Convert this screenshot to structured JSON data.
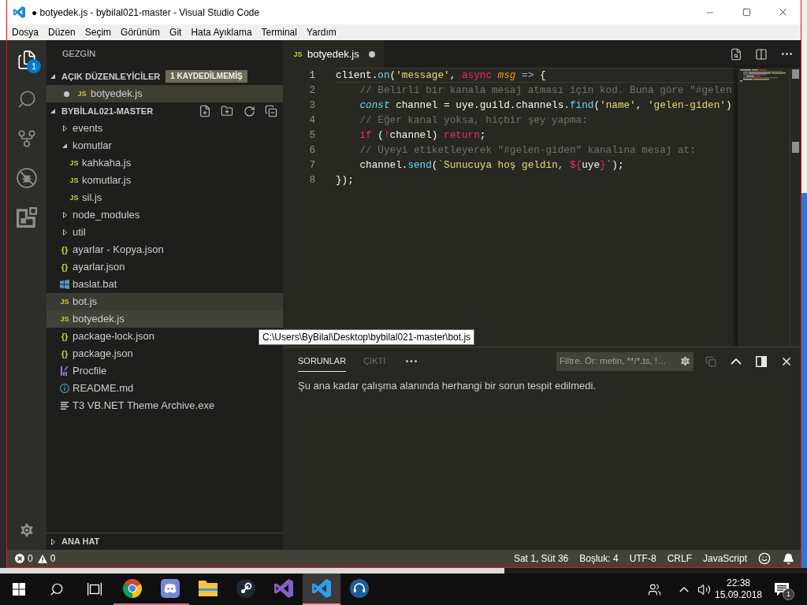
{
  "window": {
    "title": "● botyedek.js - bybilal021-master - Visual Studio Code"
  },
  "menu": [
    "Dosya",
    "Düzen",
    "Seçim",
    "Görünüm",
    "Git",
    "Hata Ayıklama",
    "Terminal",
    "Yardım"
  ],
  "activity_bar": {
    "items": [
      {
        "kind": "files",
        "selected": true,
        "badge": "1"
      },
      {
        "kind": "search",
        "selected": false
      },
      {
        "kind": "scm",
        "selected": false
      },
      {
        "kind": "debug",
        "selected": false
      },
      {
        "kind": "extensions",
        "selected": false
      }
    ]
  },
  "sidebar": {
    "title": "GEZGİN",
    "open_editors": {
      "title": "AÇIK DÜZENLEYİCİLER",
      "expanded": true,
      "badge": "1 KAYDEDİLMEMİŞ",
      "items": [
        {
          "label": "botyedek.js",
          "kind": "js",
          "icon": "JS",
          "dirty": true,
          "selected": true
        }
      ]
    },
    "folder": {
      "title": "BYBİLAL021-MASTER",
      "expanded": true,
      "items": [
        {
          "label": "events",
          "kind": "folder",
          "expanded": false,
          "selected": false,
          "hovered": false
        },
        {
          "label": "komutlar",
          "kind": "folder",
          "expanded": true,
          "selected": false,
          "hovered": false,
          "children": [
            {
              "label": "kahkaha.js",
              "kind": "js",
              "icon": "JS",
              "selected": false,
              "hovered": false
            },
            {
              "label": "komutlar.js",
              "kind": "js",
              "icon": "JS",
              "selected": false,
              "hovered": false
            },
            {
              "label": "sil.js",
              "kind": "js",
              "icon": "JS",
              "selected": false,
              "hovered": false
            }
          ]
        },
        {
          "label": "node_modules",
          "kind": "folder",
          "expanded": false,
          "selected": false,
          "hovered": false
        },
        {
          "label": "util",
          "kind": "folder",
          "expanded": false,
          "selected": false,
          "hovered": false
        },
        {
          "label": "ayarlar - Kopya.json",
          "kind": "json",
          "icon": "{}",
          "selected": false,
          "hovered": false
        },
        {
          "label": "ayarlar.json",
          "kind": "json",
          "icon": "{}",
          "selected": false,
          "hovered": false
        },
        {
          "label": "baslat.bat",
          "kind": "bat",
          "selected": false,
          "hovered": false
        },
        {
          "label": "bot.js",
          "kind": "js",
          "icon": "JS",
          "selected": false,
          "hovered": true
        },
        {
          "label": "botyedek.js",
          "kind": "js",
          "icon": "JS",
          "selected": true,
          "hovered": false
        },
        {
          "label": "package-lock.json",
          "kind": "json",
          "icon": "{}",
          "selected": false,
          "hovered": false
        },
        {
          "label": "package.json",
          "kind": "json",
          "icon": "{}",
          "selected": false,
          "hovered": false
        },
        {
          "label": "Procfile",
          "kind": "procfile",
          "selected": false,
          "hovered": false
        },
        {
          "label": "README.md",
          "kind": "md",
          "selected": false,
          "hovered": false
        },
        {
          "label": "T3 VB.NET Theme Archive.exe",
          "kind": "exe",
          "selected": false,
          "hovered": false
        }
      ]
    },
    "outline": {
      "title": "ANA HAT",
      "expanded": false
    }
  },
  "editor": {
    "tabs": [
      {
        "label": "botyedek.js",
        "kind": "js",
        "icon": "JS",
        "dirty": true,
        "selected": true
      }
    ],
    "lines": [
      {
        "number": "1",
        "current": true,
        "tokens": [
          {
            "kind": "plain",
            "text": "client."
          },
          {
            "kind": "function",
            "text": "on"
          },
          {
            "kind": "plain",
            "text": "("
          },
          {
            "kind": "string",
            "text": "'message'"
          },
          {
            "kind": "plain",
            "text": ", "
          },
          {
            "kind": "keyword",
            "text": "async "
          },
          {
            "kind": "param",
            "text": "msg"
          },
          {
            "kind": "operator",
            "text": " =>"
          },
          {
            "kind": "plain",
            "text": " {"
          }
        ]
      },
      {
        "number": "2",
        "current": false,
        "tokens": [
          {
            "kind": "comment",
            "text": "    // Belirli bir kanala mesaj atması için kod. Buna göre \"#gelen"
          }
        ]
      },
      {
        "number": "3",
        "current": false,
        "tokens": [
          {
            "kind": "storage",
            "text": "    const"
          },
          {
            "kind": "plain",
            "text": " channel = uye.guild.channels."
          },
          {
            "kind": "function",
            "text": "find"
          },
          {
            "kind": "plain",
            "text": "("
          },
          {
            "kind": "string",
            "text": "'name'"
          },
          {
            "kind": "plain",
            "text": ", "
          },
          {
            "kind": "string",
            "text": "'gelen-giden'"
          },
          {
            "kind": "plain",
            "text": ")"
          }
        ]
      },
      {
        "number": "4",
        "current": false,
        "tokens": [
          {
            "kind": "comment",
            "text": "    // Eğer kanal yoksa, hiçbir şey yapma:"
          }
        ]
      },
      {
        "number": "5",
        "current": false,
        "tokens": [
          {
            "kind": "keyword",
            "text": "    if"
          },
          {
            "kind": "plain",
            "text": " ("
          },
          {
            "kind": "keyword",
            "text": "!"
          },
          {
            "kind": "plain",
            "text": "channel) "
          },
          {
            "kind": "keyword",
            "text": "return"
          },
          {
            "kind": "plain",
            "text": ";"
          }
        ]
      },
      {
        "number": "6",
        "current": false,
        "tokens": [
          {
            "kind": "comment",
            "text": "    // Üyeyi etiketleyerek \"#gelen-giden\" kanalına mesaj at:"
          }
        ]
      },
      {
        "number": "7",
        "current": false,
        "tokens": [
          {
            "kind": "plain",
            "text": "    channel."
          },
          {
            "kind": "function",
            "text": "send"
          },
          {
            "kind": "plain",
            "text": "("
          },
          {
            "kind": "string",
            "text": "`Sunucuya hoş geldin, "
          },
          {
            "kind": "keyword",
            "text": "${"
          },
          {
            "kind": "plain",
            "text": "uye"
          },
          {
            "kind": "keyword",
            "text": "}"
          },
          {
            "kind": "string",
            "text": "`"
          },
          {
            "kind": "plain",
            "text": ");"
          }
        ]
      },
      {
        "number": "8",
        "current": false,
        "tokens": [
          {
            "kind": "plain",
            "text": "});"
          }
        ]
      }
    ]
  },
  "tooltip": "C:\\Users\\ByBilal\\Desktop\\bybilal021-master\\bot.js",
  "panel": {
    "tabs": [
      {
        "label": "SORUNLAR",
        "selected": true
      },
      {
        "label": "ÇIKTI",
        "selected": false
      }
    ],
    "filter": {
      "placeholder": "Filtre. Ör: metin, **/*.ts, !…"
    },
    "message": "Şu ana kadar çalışma alanında herhangi bir sorun tespit edilmedi."
  },
  "status_bar": {
    "errors": "0",
    "warnings": "0",
    "items": [
      "Sat 1, Süt 36",
      "Boşluk: 4",
      "UTF-8",
      "CRLF",
      "JavaScript"
    ]
  },
  "taskbar": {
    "apps": [
      {
        "kind": "chrome",
        "running": true,
        "active": false
      },
      {
        "kind": "discord",
        "running": true,
        "active": false
      },
      {
        "kind": "explorer",
        "running": false,
        "active": false
      },
      {
        "kind": "steam",
        "running": false,
        "active": false
      },
      {
        "kind": "visualstudio",
        "running": false,
        "active": false
      },
      {
        "kind": "vscode",
        "running": true,
        "active": true
      },
      {
        "kind": "headset",
        "running": false,
        "active": false
      }
    ],
    "time": "22:38",
    "date": "15.09.2018",
    "notifications": "1"
  }
}
